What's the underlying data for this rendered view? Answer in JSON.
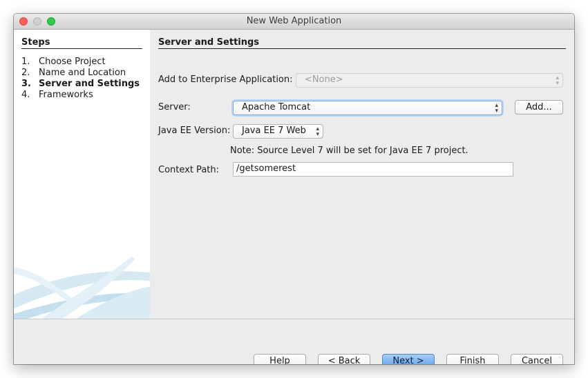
{
  "window": {
    "title": "New Web Application"
  },
  "steps": {
    "heading": "Steps",
    "items": [
      {
        "num": "1.",
        "label": "Choose Project"
      },
      {
        "num": "2.",
        "label": "Name and Location"
      },
      {
        "num": "3.",
        "label": "Server and Settings"
      },
      {
        "num": "4.",
        "label": "Frameworks"
      }
    ]
  },
  "panel": {
    "title": "Server and Settings",
    "enterprise_label": "Add to Enterprise Application:",
    "enterprise_value": "<None>",
    "server_label": "Server:",
    "server_value": "Apache Tomcat",
    "add_button": "Add...",
    "javaee_label": "Java EE Version:",
    "javaee_value": "Java EE 7 Web",
    "note": "Note: Source Level 7 will be set for Java EE 7 project.",
    "context_label": "Context Path:",
    "context_value": "/getsomerest"
  },
  "buttons": {
    "help": "Help",
    "back": "< Back",
    "next": "Next >",
    "finish": "Finish",
    "cancel": "Cancel"
  }
}
